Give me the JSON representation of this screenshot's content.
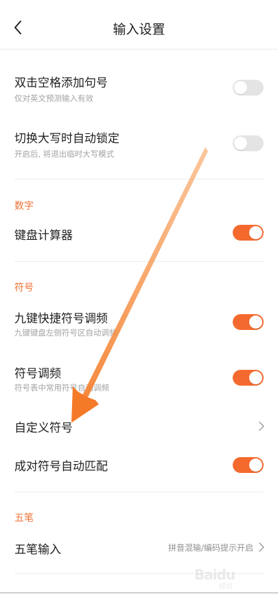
{
  "header": {
    "title": "输入设置"
  },
  "rows": {
    "double_space": {
      "title": "双击空格添加句号",
      "subtitle": "仅对英文预测输入有效",
      "toggle_on": false
    },
    "caps_lock": {
      "title": "切换大写时自动锁定",
      "subtitle": "开启后, 将退出临时大写模式",
      "toggle_on": false
    },
    "keyboard_calc": {
      "title": "键盘计算器",
      "toggle_on": true
    },
    "nine_key": {
      "title": "九键快捷符号调频",
      "subtitle": "九键键盘左侧符号区自动调频",
      "toggle_on": true
    },
    "symbol_freq": {
      "title": "符号调频",
      "subtitle": "符号表中常用符号自动调频",
      "toggle_on": true
    },
    "custom_symbol": {
      "title": "自定义符号"
    },
    "pair_match": {
      "title": "成对符号自动匹配",
      "toggle_on": true
    },
    "wubi_input": {
      "title": "五笔输入",
      "value": "拼音混输/编码提示开启"
    }
  },
  "sections": {
    "digits": "数字",
    "symbols": "符号",
    "wubi": "五笔"
  },
  "watermark": {
    "text": "Baidu",
    "sub": "经验"
  },
  "colors": {
    "accent": "#f46a2e",
    "section_label": "#f07236",
    "toggle_off": "#e4e4e4",
    "arrow": "#f5893a"
  },
  "icons": {
    "back": "chevron-left-icon",
    "row_arrow": "chevron-right-icon"
  }
}
